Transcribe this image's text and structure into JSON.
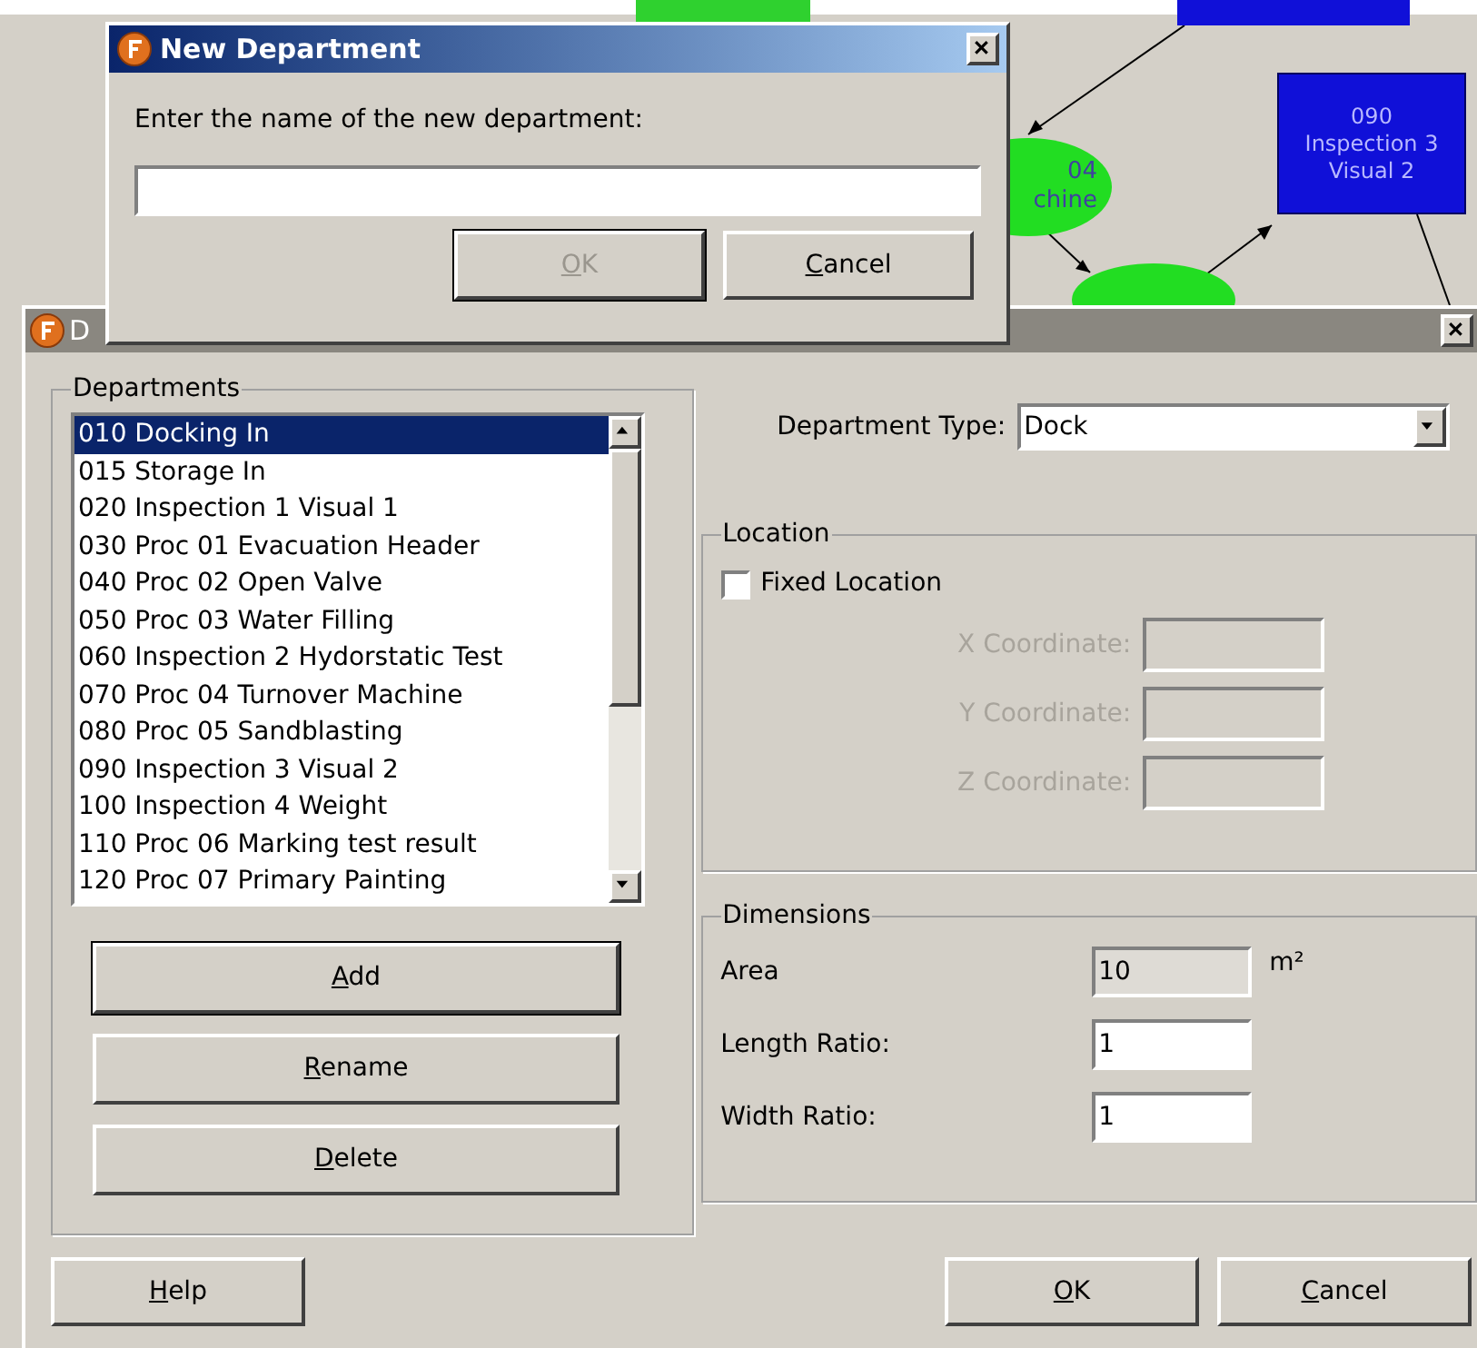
{
  "diagram": {
    "nodes": [
      {
        "kind": "ellipse",
        "lines": [
          "04",
          "chine"
        ]
      },
      {
        "kind": "box",
        "lines": [
          "090",
          "Inspection 3",
          "Visual 2"
        ]
      }
    ]
  },
  "main_dialog": {
    "title": "D",
    "departments": {
      "title": "Departments",
      "items": [
        {
          "label": "010 Docking In",
          "selected": true
        },
        {
          "label": "015 Storage In",
          "selected": false
        },
        {
          "label": "020 Inspection 1 Visual 1",
          "selected": false
        },
        {
          "label": "030 Proc 01 Evacuation Header",
          "selected": false
        },
        {
          "label": "040 Proc 02 Open Valve",
          "selected": false
        },
        {
          "label": "050 Proc 03 Water Filling",
          "selected": false
        },
        {
          "label": "060 Inspection 2 Hydorstatic Test",
          "selected": false
        },
        {
          "label": "070 Proc 04 Turnover Machine",
          "selected": false
        },
        {
          "label": "080 Proc 05 Sandblasting",
          "selected": false
        },
        {
          "label": "090 Inspection 3 Visual 2",
          "selected": false
        },
        {
          "label": "100 Inspection 4 Weight",
          "selected": false
        },
        {
          "label": "110 Proc 06 Marking test result",
          "selected": false
        },
        {
          "label": "120 Proc 07 Primary Painting",
          "selected": false
        }
      ],
      "buttons": [
        {
          "label": "Add",
          "default": true,
          "mnemonic": true
        },
        {
          "label": "Rename",
          "default": false,
          "mnemonic": true
        },
        {
          "label": "Delete",
          "default": false,
          "mnemonic": true
        }
      ]
    },
    "department_type": {
      "label": "Department Type:",
      "value": "Dock"
    },
    "location": {
      "title": "Location",
      "fixed_location": {
        "label": "Fixed Location",
        "checked": false
      },
      "coordinates": [
        {
          "label": "X Coordinate:",
          "disabled": true
        },
        {
          "label": "Y Coordinate:",
          "disabled": true
        },
        {
          "label": "Z Coordinate:",
          "disabled": true
        }
      ]
    },
    "dimensions": {
      "title": "Dimensions",
      "fields": [
        {
          "label": "Area",
          "value": "10",
          "unit": "m²",
          "disabled": true
        },
        {
          "label": "Length Ratio:",
          "value": "1",
          "disabled": false
        },
        {
          "label": "Width Ratio:",
          "value": "1",
          "disabled": false
        }
      ]
    },
    "footer_buttons": [
      {
        "kind": "left",
        "label": "Help",
        "mnemonic": true
      },
      {
        "kind": "right",
        "label": "OK",
        "mnemonic": true
      },
      {
        "kind": "right",
        "label": "Cancel",
        "mnemonic": true
      }
    ]
  },
  "new_department_dialog": {
    "title": "New Department",
    "prompt": "Enter the name of the new department:",
    "buttons": [
      {
        "label": "OK",
        "disabled": true,
        "mnemonic": true
      },
      {
        "label": "Cancel",
        "disabled": false,
        "mnemonic": true
      }
    ]
  }
}
